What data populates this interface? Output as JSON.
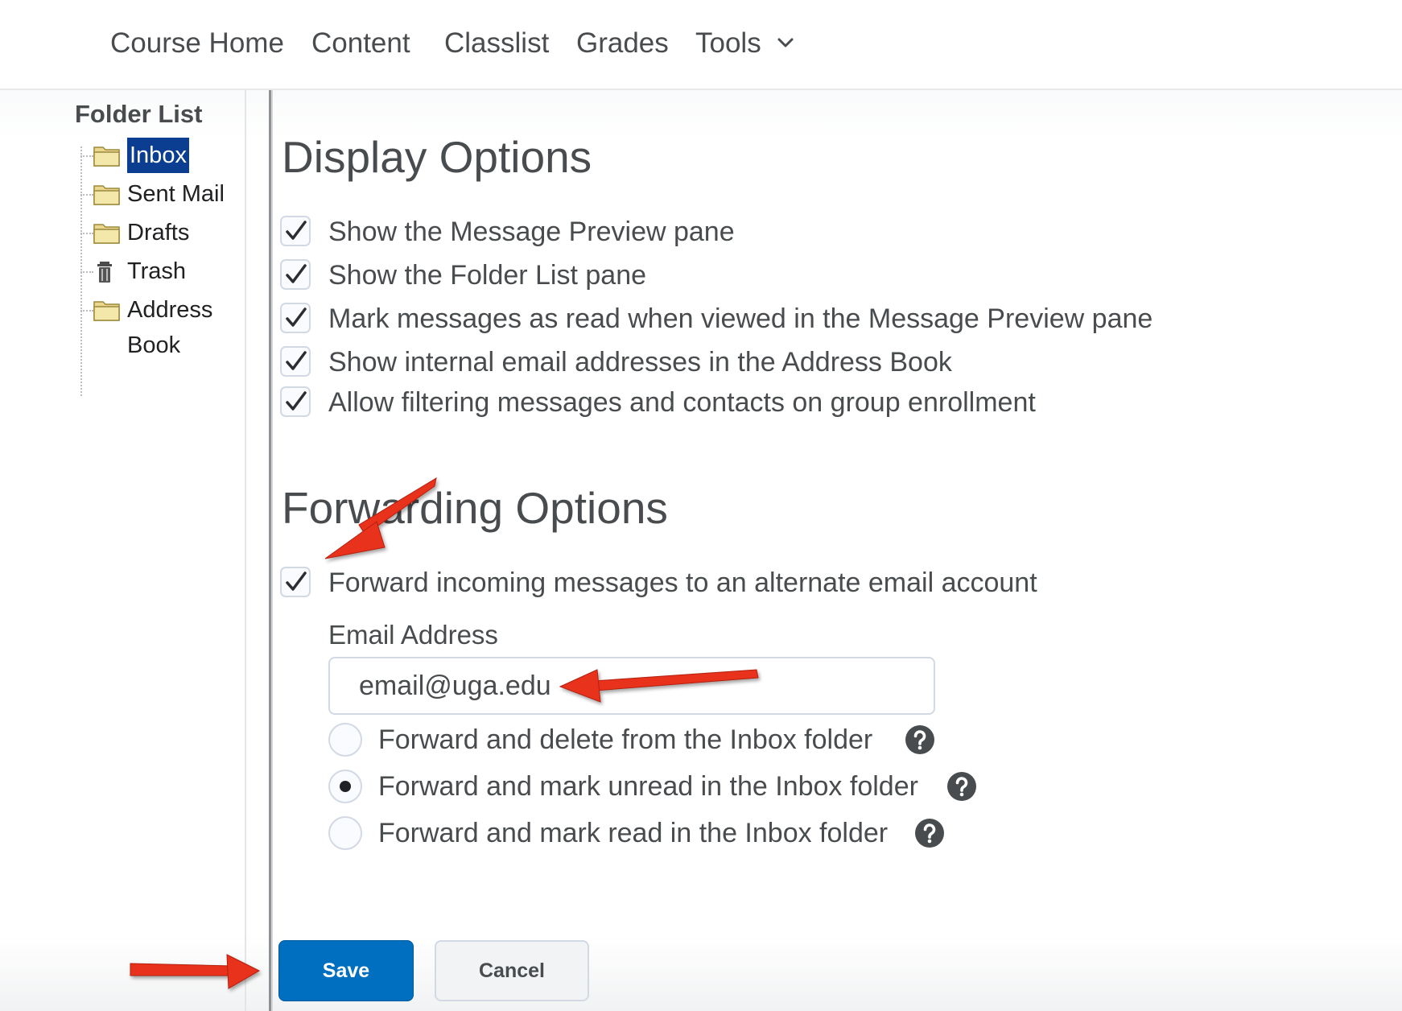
{
  "nav": {
    "items": [
      "Course Home",
      "Content",
      "Classlist",
      "Grades",
      "Tools"
    ],
    "tools_icon": "chevron-down-icon"
  },
  "sidebar": {
    "title": "Folder List",
    "folders": [
      {
        "label": "Inbox",
        "icon": "folder-icon",
        "selected": true
      },
      {
        "label": "Sent Mail",
        "icon": "folder-icon",
        "selected": false
      },
      {
        "label": "Drafts",
        "icon": "folder-icon",
        "selected": false
      },
      {
        "label": "Trash",
        "icon": "trash-icon",
        "selected": false
      },
      {
        "label": "Address Book",
        "icon": "folder-icon",
        "selected": false
      }
    ]
  },
  "display": {
    "title": "Display Options",
    "options": [
      {
        "label": "Show the Message Preview pane",
        "checked": true
      },
      {
        "label": "Show the Folder List pane",
        "checked": true
      },
      {
        "label": "Mark messages as read when viewed in the Message Preview pane",
        "checked": true
      },
      {
        "label": "Show internal email addresses in the Address Book",
        "checked": true
      },
      {
        "label": "Allow filtering messages and contacts on group enrollment",
        "checked": true
      }
    ]
  },
  "forwarding": {
    "title": "Forwarding Options",
    "forward_label": "Forward incoming messages to an alternate email account",
    "forward_checked": true,
    "email_label": "Email Address",
    "email_value": "email@uga.edu",
    "radios": [
      {
        "label": "Forward and delete from the Inbox folder",
        "selected": false
      },
      {
        "label": "Forward and mark unread in the Inbox folder",
        "selected": true
      },
      {
        "label": "Forward and mark read in the Inbox folder",
        "selected": false
      }
    ]
  },
  "buttons": {
    "save": "Save",
    "cancel": "Cancel"
  },
  "colors": {
    "primary": "#006fbf",
    "selected_bg": "#0b3d91",
    "annotation_arrow": "#e8301c",
    "text": "#494c4e"
  }
}
